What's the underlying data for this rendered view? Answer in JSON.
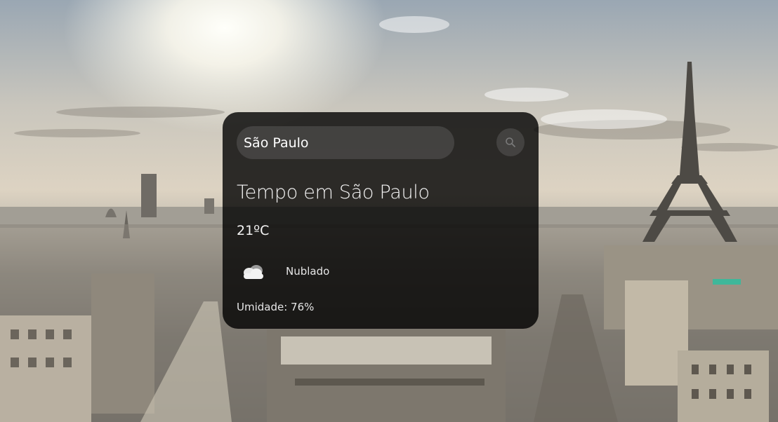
{
  "search": {
    "value": "São Paulo"
  },
  "weather": {
    "title": "Tempo em São Paulo",
    "temperature": "21ºC",
    "icon": "cloud-icon",
    "description": "Nublado",
    "humidity": "Umidade: 76%"
  },
  "colors": {
    "card_background": "#000000cc",
    "text": "#ffffff"
  }
}
